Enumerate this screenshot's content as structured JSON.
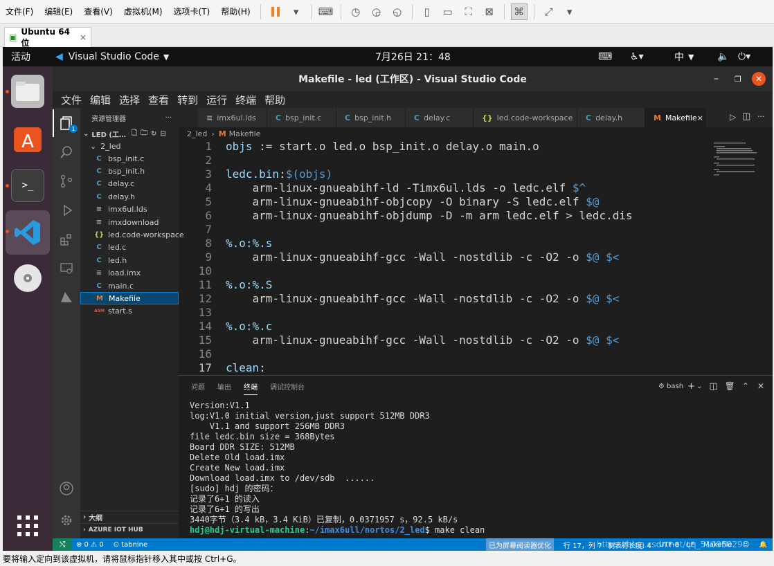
{
  "vm": {
    "menu": [
      "文件(F)",
      "编辑(E)",
      "查看(V)",
      "虚拟机(M)",
      "选项卡(T)",
      "帮助(H)"
    ],
    "tab_label": "Ubuntu 64 位",
    "tab_close": "×",
    "hint": "要将输入定向到该虚拟机，请将鼠标指针移入其中或按 Ctrl+G。"
  },
  "gnome": {
    "activities": "活动",
    "app": "Visual Studio Code",
    "clock": "7月26日  21：48",
    "ime": "中"
  },
  "vscode": {
    "title": "Makefile - led (工作区) - Visual Studio Code",
    "menu": [
      "文件",
      "编辑",
      "选择",
      "查看",
      "转到",
      "运行",
      "终端",
      "帮助"
    ],
    "explorer_title": "资源管理器",
    "explorer_more": "···",
    "root": "LED (工…",
    "folder": "2_led",
    "files": [
      {
        "icon": "C",
        "name": "bsp_init.c"
      },
      {
        "icon": "C",
        "name": "bsp_init.h"
      },
      {
        "icon": "C",
        "name": "delay.c"
      },
      {
        "icon": "C",
        "name": "delay.h"
      },
      {
        "icon": "≡",
        "name": "imx6ul.lds"
      },
      {
        "icon": "≡",
        "name": "imxdownload"
      },
      {
        "icon": "{}",
        "name": "led.code-workspace"
      },
      {
        "icon": "C",
        "name": "led.c"
      },
      {
        "icon": "C",
        "name": "led.h"
      },
      {
        "icon": "≡",
        "name": "load.imx"
      },
      {
        "icon": "C",
        "name": "main.c"
      },
      {
        "icon": "M",
        "name": "Makefile"
      },
      {
        "icon": "ASM",
        "name": "start.s"
      }
    ],
    "outline": "大纲",
    "azure": "AZURE IOT HUB",
    "tabs": [
      {
        "icon": "≡",
        "name": "imx6ul.lds"
      },
      {
        "icon": "C",
        "name": "bsp_init.c"
      },
      {
        "icon": "C",
        "name": "bsp_init.h"
      },
      {
        "icon": "C",
        "name": "delay.c"
      },
      {
        "icon": "{}",
        "name": "led.code-workspace"
      },
      {
        "icon": "C",
        "name": "delay.h"
      },
      {
        "icon": "M",
        "name": "Makefile"
      }
    ],
    "tab_close": "×",
    "breadcrumb": [
      "2_led",
      "›",
      "M",
      "Makefile"
    ],
    "badge": "1",
    "code": [
      "objs := start.o led.o bsp_init.o delay.o main.o",
      "",
      "ledc.bin:$(objs)",
      "    arm-linux-gnueabihf-ld -Timx6ul.lds -o ledc.elf $^",
      "    arm-linux-gnueabihf-objcopy -O binary -S ledc.elf $@",
      "    arm-linux-gnueabihf-objdump -D -m arm ledc.elf > ledc.dis",
      "",
      "%.o:%.s",
      "    arm-linux-gnueabihf-gcc -Wall -nostdlib -c -O2 -o $@ $<",
      "",
      "%.o:%.S",
      "    arm-linux-gnueabihf-gcc -Wall -nostdlib -c -O2 -o $@ $<",
      "",
      "%.o:%.c",
      "    arm-linux-gnueabihf-gcc -Wall -nostdlib -c -O2 -o $@ $<",
      "",
      "clean:"
    ],
    "line_numbers": [
      "1",
      "2",
      "3",
      "4",
      "5",
      "6",
      "7",
      "8",
      "9",
      "10",
      "11",
      "12",
      "13",
      "14",
      "15",
      "16",
      "17"
    ],
    "panel_tabs": [
      "问题",
      "输出",
      "终端",
      "调试控制台"
    ],
    "shell": "bash",
    "terminal": [
      "Version:V1.1",
      "log:V1.0 initial version,just support 512MB DDR3",
      "    V1.1 and support 256MB DDR3",
      "file ledc.bin size = 368Bytes",
      "Board DDR SIZE: 512MB",
      "Delete Old load.imx",
      "Create New load.imx",
      "Download load.imx to /dev/sdb  ......",
      "[sudo] hdj 的密码：",
      "记录了6+1 的读入",
      "记录了6+1 的写出",
      "3440字节（3.4 kB，3.4 KiB）已复制，0.0371957 s，92.5 kB/s"
    ],
    "prompt_user": "hdj@hdj-virtual-machine",
    "prompt_sep": ":",
    "prompt_path": "~/imax6ull/nortos/2_led",
    "prompt_cmd": "$ make clean",
    "status_left": [
      "⊗ 0 ⚠ 0",
      "⊙ tabnine"
    ],
    "status_right": [
      "已为屏幕阅读器优化",
      "行 17，列 7",
      "制表符长度: 4",
      "UTF-8",
      "LF",
      "Makefile"
    ],
    "watermark": "https://blog.csdn.net/qq_51095029"
  },
  "colors": {
    "accent": "#007acc",
    "ubuntu_dock": "#3b2a38",
    "selection": "#094771"
  }
}
